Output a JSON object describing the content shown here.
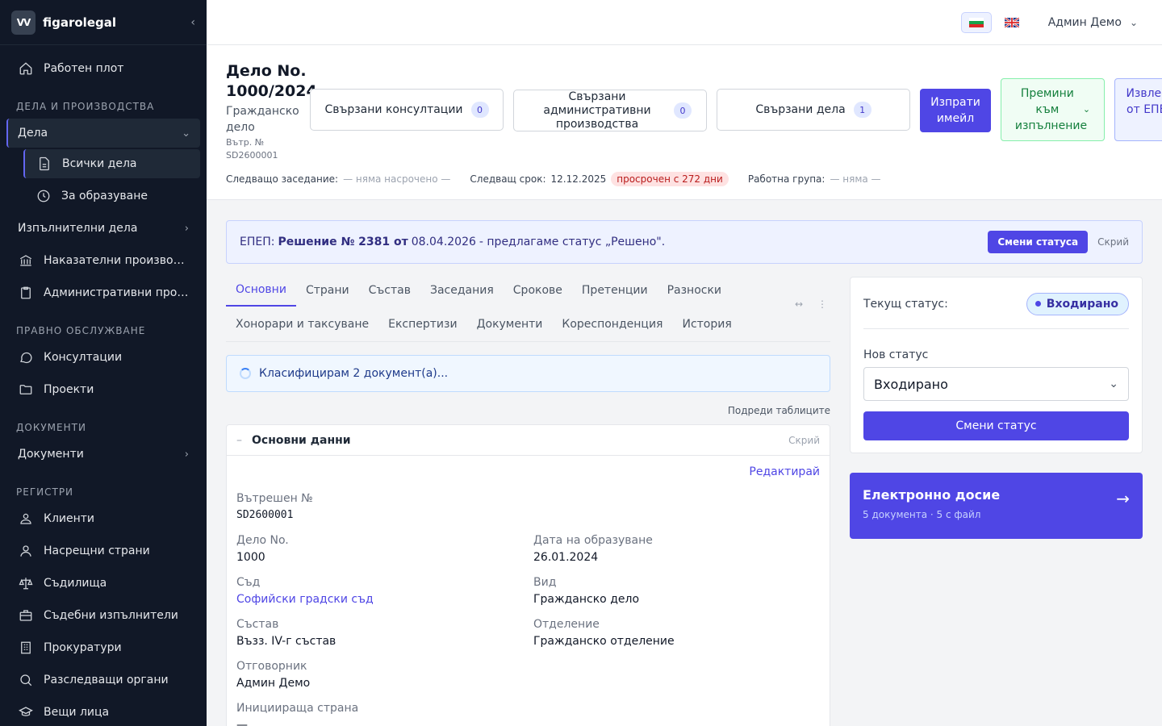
{
  "brand": {
    "name": "figarolegal",
    "logo_text": "VV"
  },
  "sidebar": {
    "dashboard": "Работен плот",
    "section_cases": "ДЕЛА И ПРОИЗВОДСТВА",
    "cases": "Дела",
    "all_cases": "Всички дела",
    "to_institute": "За образуване",
    "enforcement": "Изпълнителни дела",
    "criminal": "Наказателни производства",
    "administrative": "Административни производства",
    "section_legal": "ПРАВНО ОБСЛУЖВАНЕ",
    "consultations": "Консултации",
    "projects": "Проекти",
    "section_docs": "ДОКУМЕНТИ",
    "documents": "Документи",
    "section_registers": "РЕГИСТРИ",
    "clients": "Клиенти",
    "counterparties": "Насрещни страни",
    "courts": "Съдилища",
    "bailiffs": "Съдебни изпълнители",
    "prosecutors": "Прокуратури",
    "investigators": "Разследващи органи",
    "experts": "Вещи лица"
  },
  "topbar": {
    "user": "Админ Демо"
  },
  "case": {
    "title": "Дело No. 1000/2024",
    "type": "Гражданско дело",
    "internal_label": "Вътр. №",
    "internal_no": "SD2600001",
    "related_consultations": "Свързани консултации",
    "related_consultations_count": "0",
    "related_admin": "Свързани административни производства",
    "related_admin_count": "0",
    "related_cases": "Свързани дела",
    "related_cases_count": "1",
    "send_email": "Изпрати имейл",
    "to_enforcement": "Премини към изпълнение",
    "extract_epep": "Извлечи от ЕПЕП",
    "next_hearing_label": "Следващо заседание:",
    "next_hearing": "— няма насрочено —",
    "next_deadline_label": "Следващ срок:",
    "next_deadline": "12.12.2025",
    "overdue": "просрочен с 272 дни",
    "work_group_label": "Работна група:",
    "work_group": "— няма —"
  },
  "banner": {
    "prefix": "ЕПЕП:",
    "decision": "Решение № 2381 от",
    "date": "08.04.2026",
    "suggest": "- предлагаме статус „Решено\".",
    "button": "Смени статуса",
    "hide": "Скрий"
  },
  "tabs": {
    "row1": [
      "Основни",
      "Страни",
      "Състав",
      "Заседания",
      "Срокове",
      "Претенции",
      "Разноски"
    ],
    "row2": [
      "Хонорари и таксуване",
      "Експертизи",
      "Документи",
      "Кореспонденция",
      "История"
    ],
    "active": "Основни"
  },
  "classify": "Класифицирам 2 документ(а)...",
  "arrange": "Подреди таблиците",
  "basic": {
    "title": "Основни данни",
    "hide": "Скрий",
    "edit": "Редактирай",
    "internal_no_label": "Вътрешен №",
    "internal_no": "SD2600001",
    "case_no_label": "Дело No.",
    "case_no": "1000",
    "date_label": "Дата на образуване",
    "date": "26.01.2024",
    "court_label": "Съд",
    "court": "Софийски градски съд",
    "kind_label": "Вид",
    "kind": "Гражданско дело",
    "panel_label": "Състав",
    "panel": "Възз. IV-г състав",
    "division_label": "Отделение",
    "division": "Гражданско отделение",
    "responsible_label": "Отговорник",
    "responsible": "Админ Демо",
    "initiator_label": "Инициираща страна",
    "initiator": "—"
  },
  "status": {
    "current_label": "Текущ статус:",
    "current": "Входирано",
    "new_label": "Нов статус",
    "new_value": "Входирано",
    "button": "Смени статус"
  },
  "edossier": {
    "title": "Електронно досие",
    "sub": "5 документа · 5 с файл"
  }
}
